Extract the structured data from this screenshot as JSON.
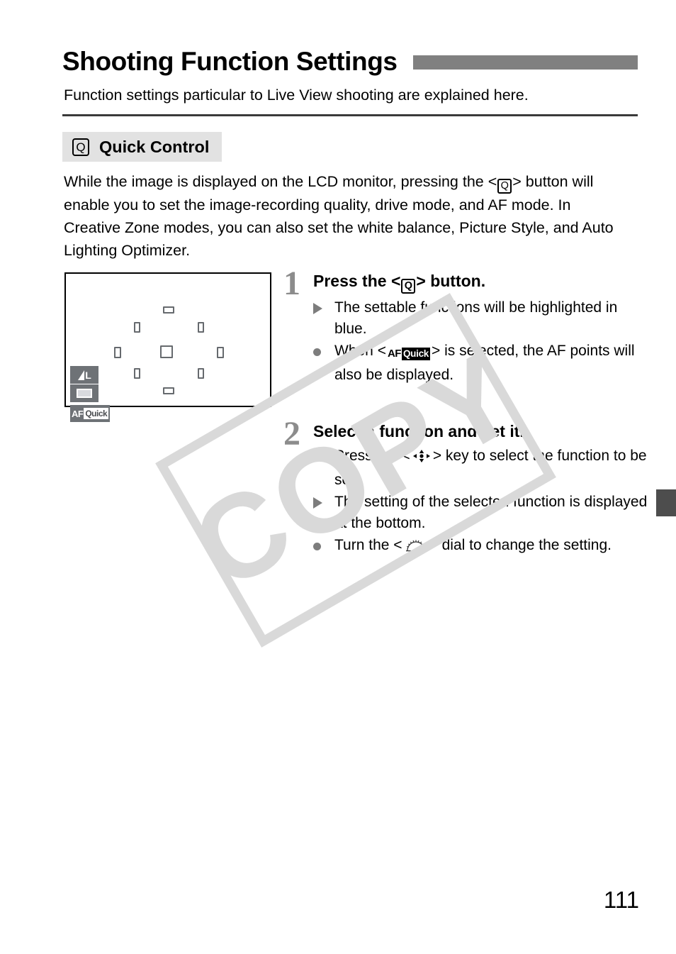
{
  "page": {
    "title": "Shooting Function Settings",
    "subtitle": "Function settings particular to Live View shooting are explained here.",
    "page_number": "111",
    "watermark": "COPY"
  },
  "section": {
    "icon": "q-button-icon",
    "icon_label": "Q",
    "title": "Quick Control"
  },
  "intro": {
    "part1": "While the image is displayed on the LCD monitor, pressing the <",
    "q_label": "Q",
    "part2": "> button will enable you to set the image-recording quality, drive mode, and AF mode. In Creative Zone modes, you can also set the white balance, Picture Style, and Auto Lighting Optimizer."
  },
  "lcd": {
    "name": "live-view-lcd-illustration",
    "icons": {
      "quality_label": "L",
      "drive_label": "single-shooting-icon",
      "af_prefix": "AF",
      "af_mode": "Quick"
    },
    "af_points": [
      {
        "name": "af-point-top",
        "shape": "h"
      },
      {
        "name": "af-point-top-left",
        "shape": "d"
      },
      {
        "name": "af-point-top-right",
        "shape": "d"
      },
      {
        "name": "af-point-left",
        "shape": "v"
      },
      {
        "name": "af-point-center",
        "shape": "center"
      },
      {
        "name": "af-point-right",
        "shape": "v"
      },
      {
        "name": "af-point-bottom-left",
        "shape": "d"
      },
      {
        "name": "af-point-bottom-right",
        "shape": "d"
      },
      {
        "name": "af-point-bottom",
        "shape": "h"
      }
    ]
  },
  "steps": [
    {
      "number": "1",
      "heading_part1": "Press the <",
      "heading_q": "Q",
      "heading_part2": "> button.",
      "bullets": [
        {
          "mark": "triangle",
          "text": "The settable functions will be highlighted in blue."
        },
        {
          "mark": "dot",
          "text_part1": "When <",
          "inline_icon": "af-quick-icon",
          "icon_prefix": "AF",
          "icon_label": "Quick",
          "text_part2": "> is selected, the AF points will also be displayed."
        }
      ]
    },
    {
      "number": "2",
      "heading": "Select a function and set it.",
      "bullets": [
        {
          "mark": "dot",
          "text_part1": "Press the <",
          "inline_icon": "multi-controller-icon",
          "text_part2": "> key to select the function to be set."
        },
        {
          "mark": "triangle",
          "text": "The setting of the selected function is displayed at the bottom."
        },
        {
          "mark": "dot",
          "text_part1": "Turn the <",
          "inline_icon": "main-dial-icon",
          "text_part2": "> dial to change the setting."
        }
      ]
    }
  ],
  "colors": {
    "header_bar": "#808080",
    "section_band": "#e2e2e2",
    "step_number": "#8c8c8c",
    "bullet_mark": "#7d7d7d",
    "edge_tab": "#4d4d4d",
    "watermark": "#d9d9d9",
    "af_point": "#666a6e",
    "lcd_chip": "#6e7276"
  }
}
